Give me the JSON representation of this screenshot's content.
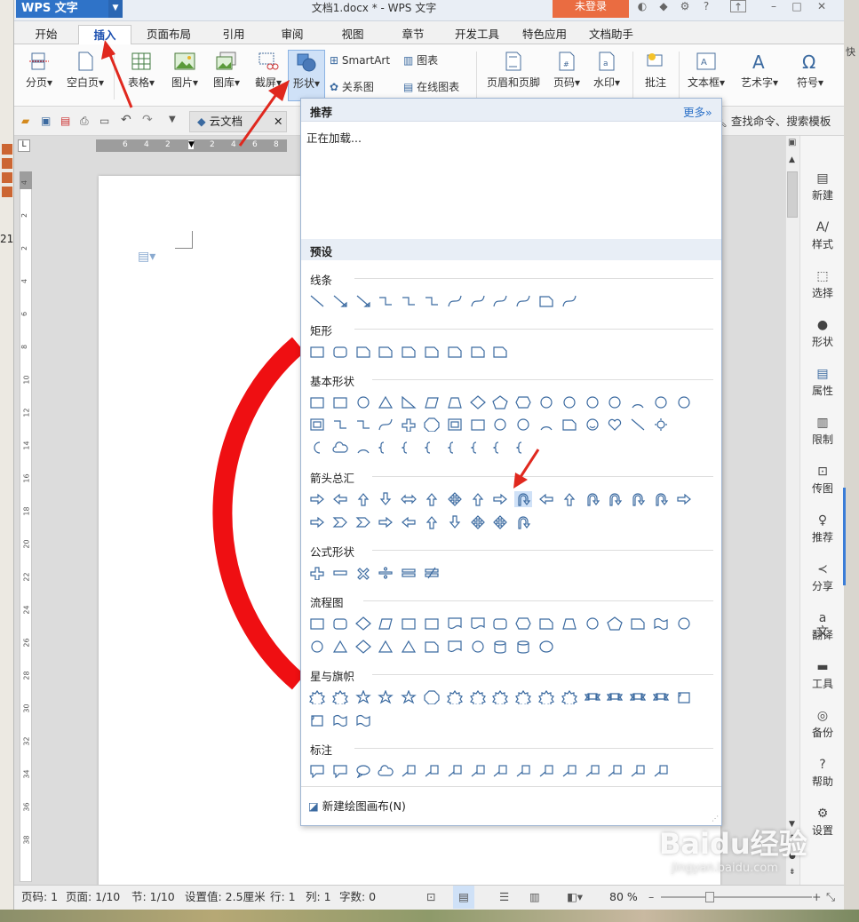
{
  "app": {
    "logo": "WPS 文字",
    "doc_title": "文档1.docx * - WPS 文字",
    "login": "未登录"
  },
  "tabs": [
    "开始",
    "插入",
    "页面布局",
    "引用",
    "审阅",
    "视图",
    "章节",
    "开发工具",
    "特色应用",
    "文档助手"
  ],
  "ribbon": {
    "fenye": "分页",
    "kongbai": "空白页",
    "biaoge": "表格",
    "tupian": "图片",
    "tuku": "图库",
    "jieping": "截屏",
    "xingzhuang": "形状",
    "smartart": "SmartArt",
    "tubiao": "图表",
    "guanxitu": "关系图",
    "zaixian": "在线图表",
    "yemei": "页眉和页脚",
    "yema": "页码",
    "shuiyin": "水印",
    "pizhu": "批注",
    "wenbenkuang": "文本框",
    "yishuzi": "艺术字",
    "fuhao": "符号"
  },
  "quick": {
    "cloud_tab": "云文档",
    "search_cmd": "查找命令、搜索模板"
  },
  "ruler_numbers": [
    "6",
    "4",
    "2",
    "2",
    "4",
    "6",
    "8"
  ],
  "vruler_numbers": [
    "4",
    "2",
    "2",
    "4",
    "6",
    "8",
    "10",
    "12",
    "14",
    "16",
    "18",
    "20",
    "22",
    "24",
    "26",
    "28",
    "30",
    "32",
    "34",
    "36",
    "38"
  ],
  "left_number": "21",
  "panel": {
    "recommend": "推荐",
    "more": "更多»",
    "loading": "正在加载...",
    "preset": "预设",
    "sections": {
      "lines": "线条",
      "rect": "矩形",
      "basic": "基本形状",
      "arrows": "箭头总汇",
      "formula": "公式形状",
      "flow": "流程图",
      "stars": "星与旗帜",
      "callouts": "标注"
    },
    "new_canvas": "新建绘图画布(N)"
  },
  "sidebar": [
    "新建",
    "样式",
    "选择",
    "形状",
    "属性",
    "限制",
    "传图",
    "推荐",
    "分享",
    "翻译",
    "工具",
    "备份",
    "帮助",
    "设置"
  ],
  "status": {
    "yema": "页码: 1",
    "yemian": "页面: 1/10",
    "jie": "节: 1/10",
    "shezhi": "设置值: 2.5厘米",
    "hang": "行: 1",
    "lie": "列: 1",
    "zishu": "字数: 0",
    "zoom": "80 %"
  },
  "watermark": {
    "brand": "Baidu经验",
    "url": "jingyan.baidu.com"
  },
  "colors": {
    "accent": "#2f73c8",
    "login": "#ea6c41",
    "arrow": "#e0281e",
    "circle": "#ef0f12"
  }
}
